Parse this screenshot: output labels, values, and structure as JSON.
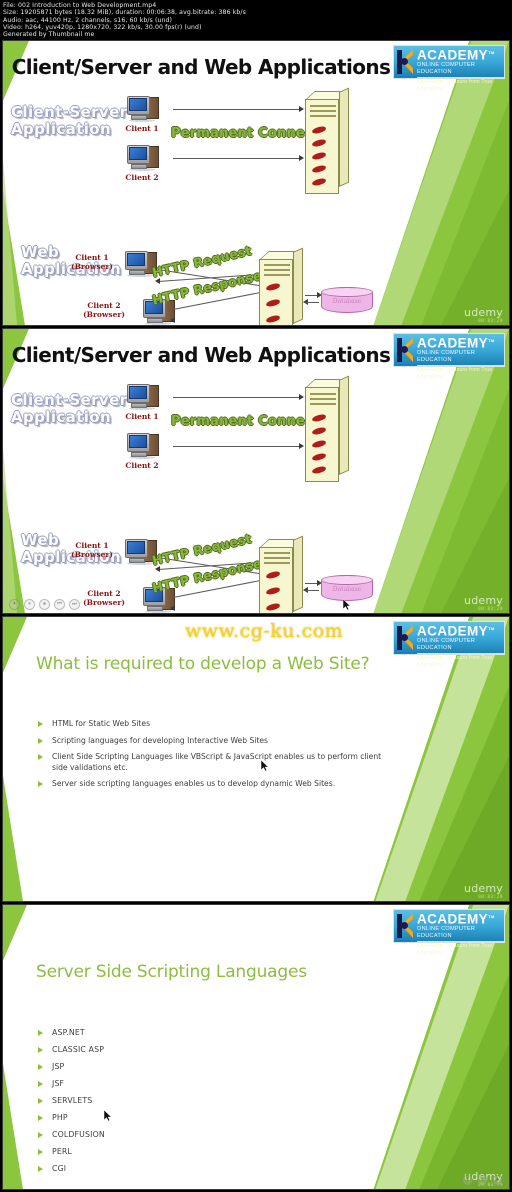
{
  "meta": {
    "lines": [
      "File: 002 Introduction to Web Development.mp4",
      "Size: 19205871 bytes (18.32 MiB), duration: 00:06:38, avg.bitrate: 386 kb/s",
      "Audio: aac, 44100 Hz, 2 channels, s16, 60 kb/s (und)",
      "Video: h264, yuv420p, 1280x720, 322 kb/s, 30.00 fps(r) (und)",
      "Generated by Thumbnail me"
    ]
  },
  "logo": {
    "title": "IT ACADEMY",
    "tm": "TM",
    "subtitle": "ONLINE COMPUTER EDUCATION",
    "tagline": "Knowledge Treasure from True Educators"
  },
  "watermarks": {
    "udemy": "udemy",
    "stamp": "00:03:29",
    "site": "www.cg-ku.com"
  },
  "player": {
    "buttons": [
      "⏵",
      "⏸",
      "⏹",
      "⏮",
      "⏭"
    ]
  },
  "slides": [
    {
      "id": "slide-1",
      "type": "diagram",
      "title": "Client/Server and Web Applications",
      "labels": {
        "client_server_app": "Client-Server\nApplication",
        "web_app": "Web\nApplication",
        "client1": "Client 1",
        "client2": "Client 2",
        "client1_browser": "Client 1\n(Browser)",
        "client2_browser": "Client 2\n(Browser)",
        "permanent_connection": "Permanent Connection",
        "http_request": "HTTP Request",
        "http_response": "HTTP Response",
        "database": "Database"
      }
    },
    {
      "id": "slide-2",
      "type": "diagram",
      "title": "Client/Server and Web Applications",
      "labels": {
        "client_server_app": "Client-Server\nApplication",
        "web_app": "Web\nApplication",
        "client1": "Client 1",
        "client2": "Client 2",
        "client1_browser": "Client 1\n(Browser)",
        "client2_browser": "Client 2\n(Browser)",
        "permanent_connection": "Permanent Connection",
        "http_request": "HTTP Request",
        "http_response": "HTTP Response",
        "database": "Database"
      }
    },
    {
      "id": "slide-3",
      "type": "text",
      "title": "What is required to develop a Web Site?",
      "bullets": [
        "HTML for Static Web Sites",
        "Scripting languages for developing Interactive Web Sites",
        "Client Side Scripting Languages like VBScript & JavaScript enables us to perform client side validations etc.",
        "Server side scripting languages enables us to develop dynamic Web Sites."
      ]
    },
    {
      "id": "slide-4",
      "type": "text",
      "title": "Server Side Scripting Languages",
      "bullets": [
        "ASP.NET",
        "CLASSIC ASP",
        "JSP",
        "JSF",
        "SERVLETS",
        "PHP",
        "COLDFUSION",
        "PERL",
        "CGI"
      ]
    }
  ],
  "colors": {
    "brand_green": "#8cbd3f",
    "logo_blue": "#2a9bd0",
    "title_black": "#111111",
    "bullet_text": "#3d3d3d",
    "watermark_yellow": "#ffd400"
  }
}
